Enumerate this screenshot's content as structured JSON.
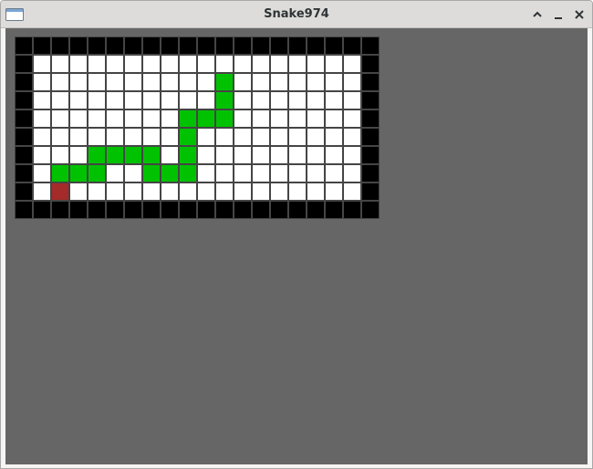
{
  "window": {
    "title": "Snake974",
    "icons": {
      "app": "window-icon",
      "maximize": "chevron-up-icon",
      "minimize": "minimize-icon",
      "close": "close-icon"
    }
  },
  "game": {
    "cols": 20,
    "rows": 10,
    "colors": {
      "wall": "#000000",
      "empty": "#ffffff",
      "snake": "#00c200",
      "food": "#a52a2a",
      "background": "#666666"
    },
    "snake": [
      [
        11,
        2
      ],
      [
        11,
        3
      ],
      [
        11,
        4
      ],
      [
        10,
        4
      ],
      [
        9,
        4
      ],
      [
        9,
        5
      ],
      [
        9,
        6
      ],
      [
        9,
        7
      ],
      [
        8,
        7
      ],
      [
        7,
        7
      ],
      [
        7,
        6
      ],
      [
        6,
        6
      ],
      [
        5,
        6
      ],
      [
        4,
        6
      ],
      [
        4,
        7
      ],
      [
        3,
        7
      ],
      [
        2,
        7
      ]
    ],
    "food": [
      2,
      8
    ]
  }
}
